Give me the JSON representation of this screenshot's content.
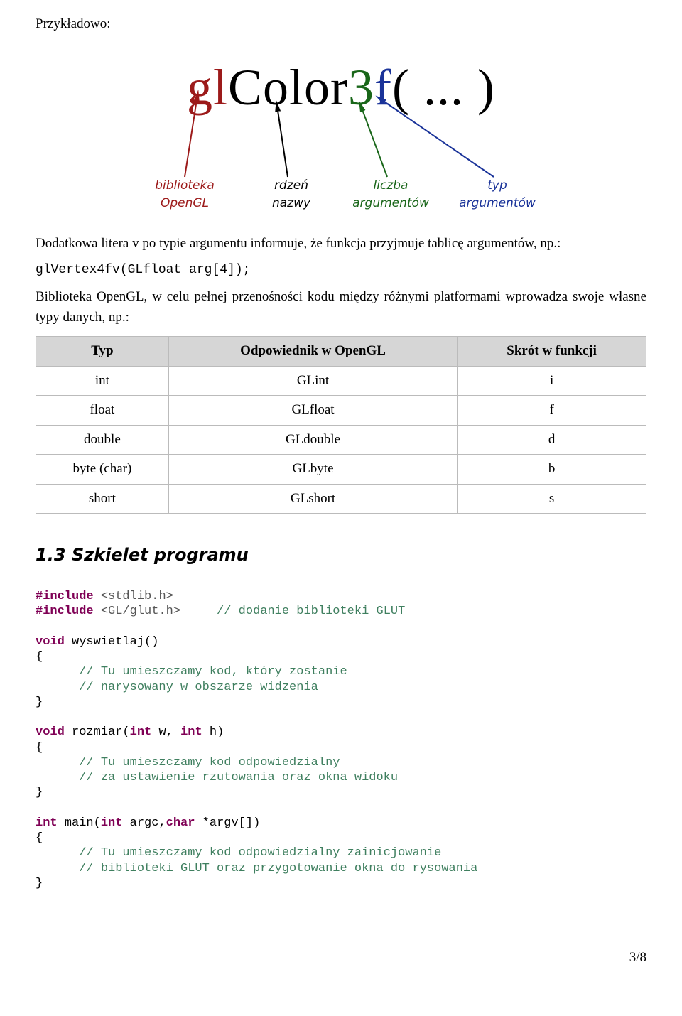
{
  "intro_heading": "Przykładowo:",
  "diagram": {
    "gl": "gl",
    "stem": "Color",
    "nargs": "3",
    "atype": "f",
    "paren_open": "(",
    "ellipsis": " ... ",
    "paren_close": ")",
    "label1a": "biblioteka",
    "label1b": "OpenGL",
    "label2a": "rdzeń",
    "label2b": "nazwy",
    "label3a": "liczba",
    "label3b": "argumentów",
    "label4a": "typ",
    "label4b": "argumentów"
  },
  "para1": "Dodatkowa litera v po typie argumentu informuje, że funkcja przyjmuje tablicę argumentów, np.:",
  "codeline1": "glVertex4fv(GLfloat arg[4]);",
  "para2": "Biblioteka OpenGL, w celu pełnej przenośności kodu między różnymi platformami wprowadza swoje własne typy danych, np.:",
  "table": {
    "h1": "Typ",
    "h2": "Odpowiednik w OpenGL",
    "h3": "Skrót w funkcji",
    "rows": [
      {
        "c1": "int",
        "c2": "GLint",
        "c3": "i"
      },
      {
        "c1": "float",
        "c2": "GLfloat",
        "c3": "f"
      },
      {
        "c1": "double",
        "c2": "GLdouble",
        "c3": "d"
      },
      {
        "c1": "byte (char)",
        "c2": "GLbyte",
        "c3": "b"
      },
      {
        "c1": "short",
        "c2": "GLshort",
        "c3": "s"
      }
    ]
  },
  "section_heading": "1.3 Szkielet programu",
  "code": {
    "kw_include": "#include",
    "inc1": " <stdlib.h>",
    "inc2": " <GL/glut.h>",
    "cmt_inc2": "     // dodanie biblioteki GLUT",
    "kw_void": "void",
    "fn1_sig": " wyswietlaj()",
    "brace_open": "{",
    "brace_close": "}",
    "cmt1a": "      // Tu umieszczamy kod, który zostanie",
    "cmt1b": "      // narysowany w obszarze widzenia",
    "fn2_sig_a": " rozmiar(",
    "kw_int": "int",
    "fn2_sig_b": " w, ",
    "fn2_sig_c": " h)",
    "cmt2a": "      // Tu umieszczamy kod odpowiedzialny",
    "cmt2b": "      // za ustawienie rzutowania oraz okna widoku",
    "fn3_sig_a": " main(",
    "fn3_sig_b": " argc,",
    "kw_char": "char",
    "fn3_sig_c": " *argv[])",
    "cmt3a": "      // Tu umieszczamy kod odpowiedzialny zainicjowanie",
    "cmt3b": "      // biblioteki GLUT oraz przygotowanie okna do rysowania"
  },
  "pagenum": "3/8"
}
